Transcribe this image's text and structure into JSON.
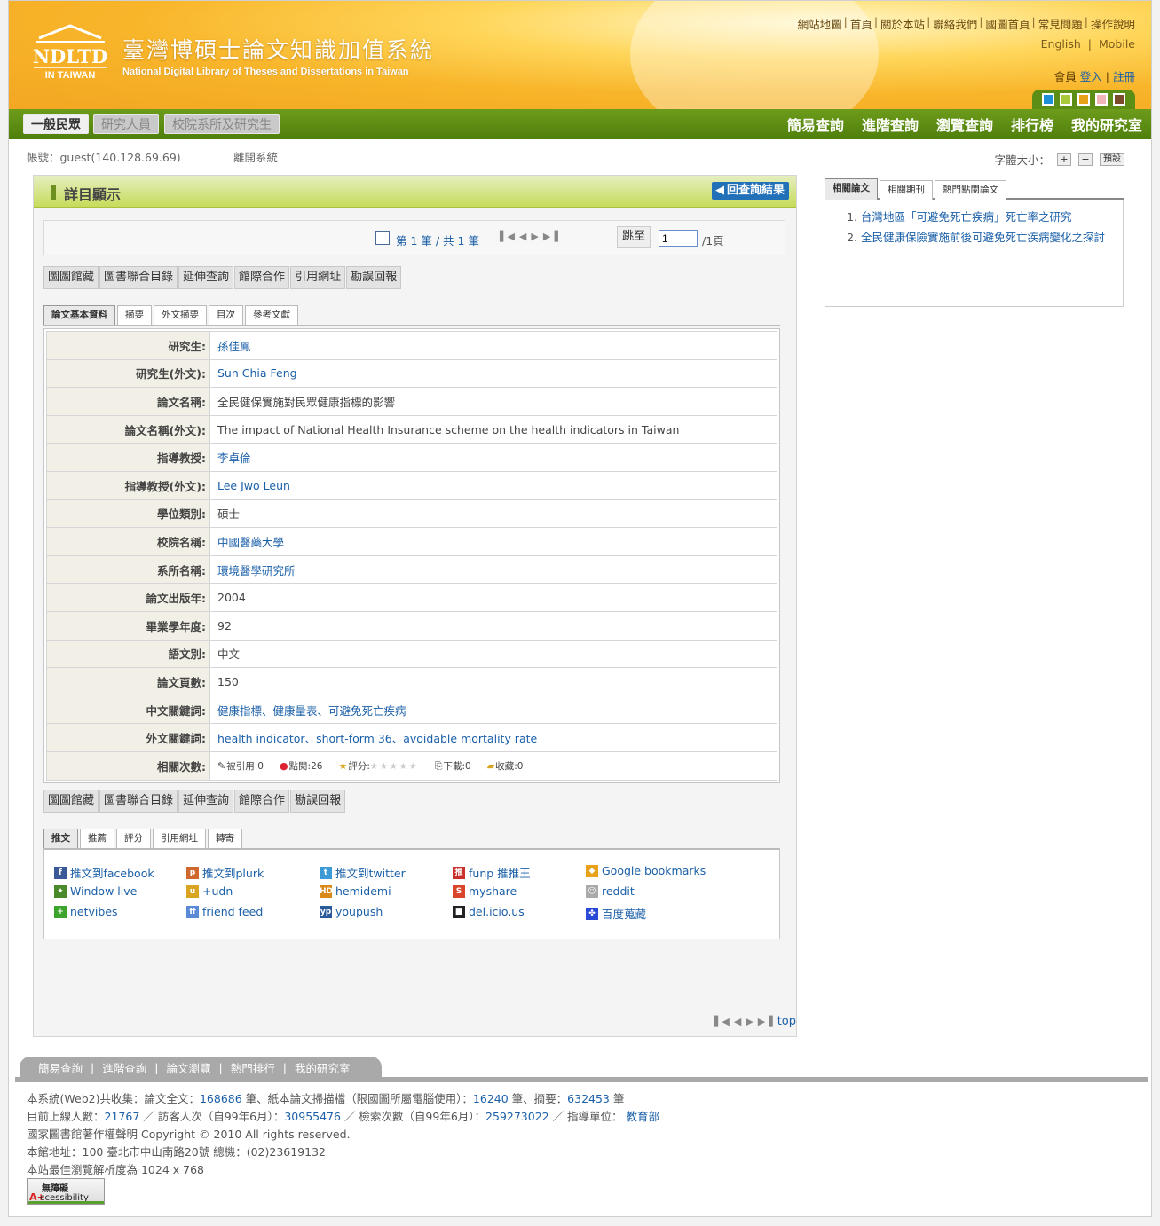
{
  "header": {
    "logo_text": "NDLTD",
    "logo_sub": "IN TAIWAN",
    "title": "臺灣博碩士論文知識加值系統",
    "subtitle": "National Digital Library of Theses and Dissertations in Taiwan",
    "top_links": [
      "網站地圖",
      "首頁",
      "關於本站",
      "聯絡我們",
      "國圖首頁",
      "常見問題",
      "操作說明"
    ],
    "lang_en": "English",
    "lang_mobile": "Mobile",
    "member_label": "會員",
    "login": "登入",
    "register": "註冊",
    "swatch_colors": [
      "#1c8fd6",
      "#a7c93a",
      "#e8a21a",
      "#f0b6b8",
      "#7a4a2a"
    ]
  },
  "nav": {
    "left_tabs": [
      "一般民眾",
      "研究人員",
      "校院系所及研究生"
    ],
    "right_links": [
      "簡易查詢",
      "進階查詢",
      "瀏覽查詢",
      "排行榜",
      "我的研究室"
    ]
  },
  "account": {
    "label": "帳號：guest(140.128.69.69)",
    "logout": "離開系統",
    "font_size_label": "字體大小：",
    "font_plus": "+",
    "font_minus": "−",
    "font_default": "預設"
  },
  "detail": {
    "title": "詳目顯示",
    "back_button": "回查詢結果",
    "pager": {
      "count_text": "第 1 筆 / 共 1 筆",
      "jump_label": "跳至",
      "page_value": "1",
      "page_total": "/1頁"
    },
    "action_buttons": [
      "圖圖館藏",
      "圖書聯合目錄",
      "延伸查詢",
      "館際合作",
      "引用網址",
      "勘誤回報"
    ],
    "action_buttons_bottom": [
      "圖圖館藏",
      "圖書聯合目錄",
      "延伸查詢",
      "館際合作",
      "勘誤回報"
    ],
    "tabs": [
      "論文基本資料",
      "摘要",
      "外文摘要",
      "目次",
      "參考文獻"
    ],
    "fields": [
      {
        "label": "研究生:",
        "value": "孫佳鳳",
        "link": true
      },
      {
        "label": "研究生(外文):",
        "value": "Sun Chia Feng",
        "link": true
      },
      {
        "label": "論文名稱:",
        "value": "全民健保實施對民眾健康指標的影響",
        "link": false
      },
      {
        "label": "論文名稱(外文):",
        "value": "The impact of National Health Insurance scheme on the health indicators in Taiwan",
        "link": false
      },
      {
        "label": "指導教授:",
        "value": "李卓倫",
        "link": true
      },
      {
        "label": "指導教授(外文):",
        "value": "Lee Jwo Leun",
        "link": true
      },
      {
        "label": "學位類別:",
        "value": "碩士",
        "link": false
      },
      {
        "label": "校院名稱:",
        "value": "中國醫藥大學",
        "link": true
      },
      {
        "label": "系所名稱:",
        "value": "環境醫學研究所",
        "link": true
      },
      {
        "label": "論文出版年:",
        "value": "2004",
        "link": false
      },
      {
        "label": "畢業學年度:",
        "value": "92",
        "link": false
      },
      {
        "label": "語文別:",
        "value": "中文",
        "link": false
      },
      {
        "label": "論文頁數:",
        "value": "150",
        "link": false
      },
      {
        "label": "中文關鍵詞:",
        "value": "健康指標、健康量表、可避免死亡疾病",
        "link": true
      },
      {
        "label": "外文關鍵詞:",
        "value": "health indicator、short-form 36、avoidable mortality rate",
        "link": true
      }
    ],
    "stats_label": "相關次數:",
    "stats": {
      "cited": "被引用:0",
      "clicks": "點閱:26",
      "rating": "評分:",
      "downloads": "下載:0",
      "bookmarks": "收藏:0"
    },
    "share_tabs": [
      "推文",
      "推薦",
      "評分",
      "引用網址",
      "轉寄"
    ],
    "share_items": [
      {
        "label": "推文到facebook",
        "icon": "facebook-icon",
        "color": "#3b5998",
        "glyph": "f"
      },
      {
        "label": "推文到plurk",
        "icon": "plurk-icon",
        "color": "#cf682f",
        "glyph": "p"
      },
      {
        "label": "推文到twitter",
        "icon": "twitter-icon",
        "color": "#3d9ad6",
        "glyph": "t"
      },
      {
        "label": "funp 推推王",
        "icon": "funp-icon",
        "color": "#c9302c",
        "glyph": "推"
      },
      {
        "label": "Google bookmarks",
        "icon": "google-bookmarks-icon",
        "color": "#e8a21a",
        "glyph": "◆"
      },
      {
        "label": "Window live",
        "icon": "windows-live-icon",
        "color": "#4a8a2a",
        "glyph": "✦"
      },
      {
        "label": "+udn",
        "icon": "udn-icon",
        "color": "#d9a520",
        "glyph": "u"
      },
      {
        "label": "hemidemi",
        "icon": "hemidemi-icon",
        "color": "#d98a1a",
        "glyph": "HD"
      },
      {
        "label": "myshare",
        "icon": "myshare-icon",
        "color": "#d9452a",
        "glyph": "S"
      },
      {
        "label": "reddit",
        "icon": "reddit-icon",
        "color": "#aaaaaa",
        "glyph": "☺"
      },
      {
        "label": "netvibes",
        "icon": "netvibes-icon",
        "color": "#3aa52a",
        "glyph": "+"
      },
      {
        "label": "friend feed",
        "icon": "friendfeed-icon",
        "color": "#5a8ad6",
        "glyph": "ff"
      },
      {
        "label": "youpush",
        "icon": "youpush-icon",
        "color": "#2a5a9a",
        "glyph": "yp"
      },
      {
        "label": "del.icio.us",
        "icon": "delicious-icon",
        "color": "#222222",
        "glyph": "■"
      },
      {
        "label": "百度蒐藏",
        "icon": "baidu-icon",
        "color": "#2a4ad6",
        "glyph": "✤"
      }
    ],
    "bottom_top": "top"
  },
  "side": {
    "tabs": [
      "相關論文",
      "相關期刊",
      "熱門點閱論文"
    ],
    "items": [
      "台灣地區「可避免死亡疾病」死亡率之研究",
      "全民健康保險實施前後可避免死亡疾病變化之探討"
    ]
  },
  "footer": {
    "tabs": [
      "簡易查詢",
      "進階查詢",
      "論文瀏覽",
      "熱門排行",
      "我的研究室"
    ],
    "line1_a": "本系統(Web2)共收集：論文全文：",
    "fulltext": "168686",
    "line1_b": " 筆、紙本論文掃描檔（限國圖所屬電腦使用）：",
    "scans": "16240",
    "line1_c": " 筆、摘要：",
    "abstracts": "632453",
    "line1_d": " 筆",
    "line2_a": "目前上線人數：",
    "online": "21767",
    "line2_b": " ／ 訪客人次（自99年6月）：",
    "visitors": "30955476",
    "line2_c": " ／ 檢索次數（自99年6月）：",
    "searches": "259273022",
    "line2_d": " ／ 指導單位： ",
    "ministry": "教育部",
    "line3": "國家圖書館著作權聲明 Copyright © 2010 All rights reserved.",
    "line4": "本館地址：100 臺北市中山南路20號 總機：(02)23619132",
    "line5": "本站最佳瀏覽解析度為 1024 x 768",
    "badge_line1": "無障礙",
    "badge_aplus": "A+",
    "badge_line2": "ccessibility"
  }
}
